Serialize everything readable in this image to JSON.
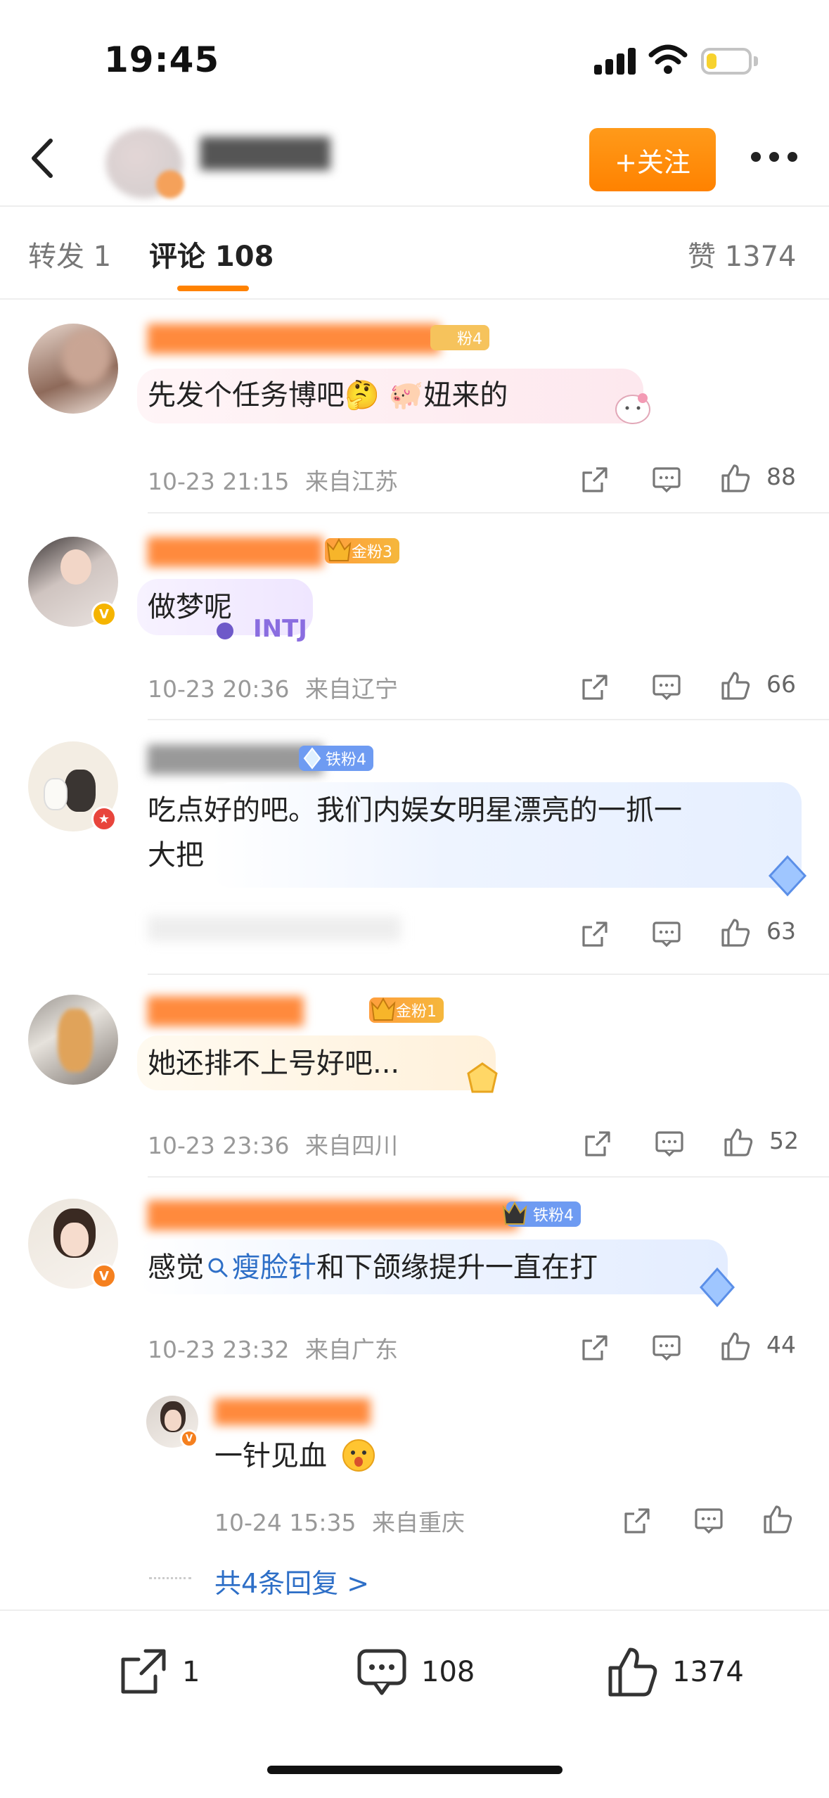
{
  "status_bar": {
    "time": "19:45",
    "battery_level": 0.25
  },
  "header": {
    "follow_label": "+关注"
  },
  "tabs": {
    "repost": "转发 1",
    "comments": "评论 108",
    "likes": "赞 1374"
  },
  "comments": [
    {
      "badge": "粉4",
      "text": "先发个任务博吧🤔 🐖妞来的",
      "time": "10-23 21:15",
      "location": "来自江苏",
      "likes": "88"
    },
    {
      "badge": "金粉3",
      "text": "做梦呢",
      "time": "10-23 20:36",
      "location": "来自辽宁",
      "likes": "66"
    },
    {
      "badge": "铁粉4",
      "text_line1": "吃点好的吧。我们内娱女明星漂亮的一抓一",
      "text_line2": "大把",
      "likes": "63"
    },
    {
      "badge": "金粉1",
      "text": "她还排不上号好吧...",
      "time": "10-23 23:36",
      "location": "来自四川",
      "likes": "52"
    },
    {
      "badge": "铁粉4",
      "text_prefix": "感觉",
      "hashtag": "瘦脸针",
      "text_suffix": "和下颌缘提升一直在打",
      "time": "10-23 23:32",
      "location": "来自广东",
      "likes": "44"
    }
  ],
  "reply": {
    "text": "一针见血",
    "time": "10-24 15:35",
    "location": "来自重庆",
    "more_replies": "共4条回复 >"
  },
  "bottom_bar": {
    "repost_count": "1",
    "comment_count": "108",
    "like_count": "1374"
  },
  "colors": {
    "accent": "#ff8200",
    "link": "#2e6fc7",
    "meta_text": "#999999"
  }
}
